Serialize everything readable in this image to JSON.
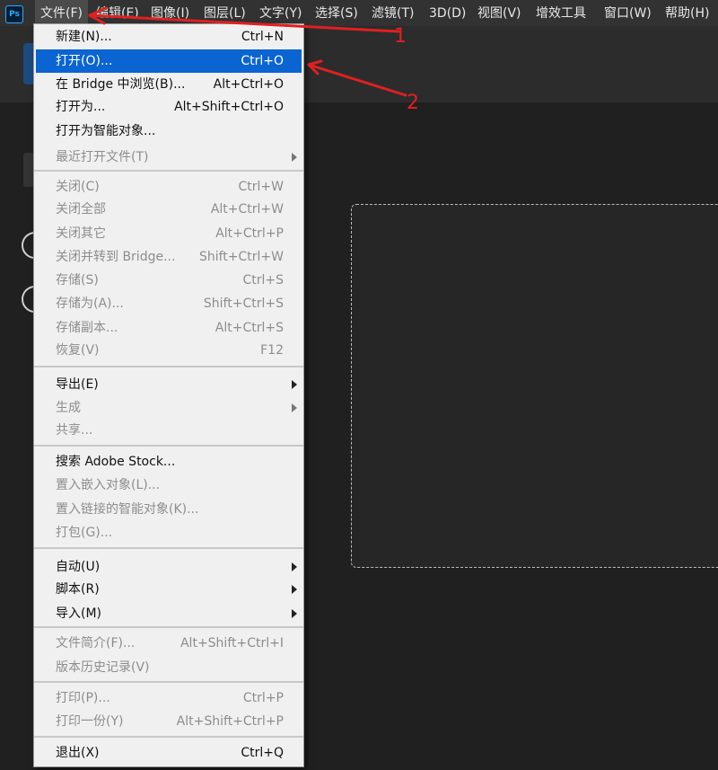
{
  "app": {
    "logo": "Ps"
  },
  "menubar": {
    "items": [
      "文件(F)",
      "编辑(E)",
      "图像(I)",
      "图层(L)",
      "文字(Y)",
      "选择(S)",
      "滤镜(T)",
      "3D(D)",
      "视图(V)",
      "增效工具",
      "窗口(W)",
      "帮助(H)"
    ]
  },
  "file_menu": {
    "groups": [
      [
        {
          "label": "新建(N)...",
          "shortcut": "Ctrl+N",
          "enabled": true
        },
        {
          "label": "打开(O)...",
          "shortcut": "Ctrl+O",
          "enabled": true,
          "selected": true
        },
        {
          "label": "在 Bridge 中浏览(B)...",
          "shortcut": "Alt+Ctrl+O",
          "enabled": true
        },
        {
          "label": "打开为...",
          "shortcut": "Alt+Shift+Ctrl+O",
          "enabled": true
        },
        {
          "label": "打开为智能对象...",
          "shortcut": "",
          "enabled": true
        },
        {
          "label": "最近打开文件(T)",
          "shortcut": "",
          "enabled": false,
          "submenu": true
        }
      ],
      [
        {
          "label": "关闭(C)",
          "shortcut": "Ctrl+W",
          "enabled": false
        },
        {
          "label": "关闭全部",
          "shortcut": "Alt+Ctrl+W",
          "enabled": false
        },
        {
          "label": "关闭其它",
          "shortcut": "Alt+Ctrl+P",
          "enabled": false
        },
        {
          "label": "关闭并转到 Bridge...",
          "shortcut": "Shift+Ctrl+W",
          "enabled": false
        },
        {
          "label": "存储(S)",
          "shortcut": "Ctrl+S",
          "enabled": false
        },
        {
          "label": "存储为(A)...",
          "shortcut": "Shift+Ctrl+S",
          "enabled": false
        },
        {
          "label": "存储副本...",
          "shortcut": "Alt+Ctrl+S",
          "enabled": false
        },
        {
          "label": "恢复(V)",
          "shortcut": "F12",
          "enabled": false
        }
      ],
      [
        {
          "label": "导出(E)",
          "shortcut": "",
          "enabled": true,
          "submenu": true
        },
        {
          "label": "生成",
          "shortcut": "",
          "enabled": false,
          "submenu": true
        },
        {
          "label": "共享...",
          "shortcut": "",
          "enabled": false
        }
      ],
      [
        {
          "label": "搜索 Adobe Stock...",
          "shortcut": "",
          "enabled": true
        },
        {
          "label": "置入嵌入对象(L)...",
          "shortcut": "",
          "enabled": false
        },
        {
          "label": "置入链接的智能对象(K)...",
          "shortcut": "",
          "enabled": false
        },
        {
          "label": "打包(G)...",
          "shortcut": "",
          "enabled": false
        }
      ],
      [
        {
          "label": "自动(U)",
          "shortcut": "",
          "enabled": true,
          "submenu": true
        },
        {
          "label": "脚本(R)",
          "shortcut": "",
          "enabled": true,
          "submenu": true
        },
        {
          "label": "导入(M)",
          "shortcut": "",
          "enabled": true,
          "submenu": true
        }
      ],
      [
        {
          "label": "文件简介(F)...",
          "shortcut": "Alt+Shift+Ctrl+I",
          "enabled": false
        },
        {
          "label": "版本历史记录(V)",
          "shortcut": "",
          "enabled": false
        }
      ],
      [
        {
          "label": "打印(P)...",
          "shortcut": "Ctrl+P",
          "enabled": false
        },
        {
          "label": "打印一份(Y)",
          "shortcut": "Alt+Shift+Ctrl+P",
          "enabled": false
        }
      ],
      [
        {
          "label": "退出(X)",
          "shortcut": "Ctrl+Q",
          "enabled": true
        }
      ]
    ]
  },
  "annotations": {
    "arrow_color": "#e02020",
    "labels": [
      "1",
      "2"
    ]
  },
  "colors": {
    "menu_highlight": "#0a64d2",
    "menubar_bg": "#323232",
    "workspace_bg": "#202020"
  }
}
